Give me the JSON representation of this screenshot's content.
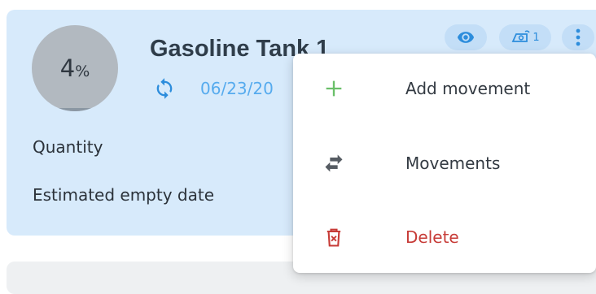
{
  "tank": {
    "percent_value": "4",
    "percent_sign": "%",
    "fill_fraction": 0.04,
    "name": "Gasoline Tank 1",
    "date": "06/23/20",
    "quantity_label": "Quantity",
    "empty_date_label": "Estimated empty date"
  },
  "badges": {
    "sensor_count": "1"
  },
  "menu": {
    "items": [
      {
        "label": "Add movement",
        "icon": "plus-icon"
      },
      {
        "label": "Movements",
        "icon": "swap-arrows-icon"
      },
      {
        "label": "Delete",
        "icon": "trash-icon"
      }
    ]
  },
  "colors": {
    "card_bg": "#d7eafb",
    "accent_blue": "#2d8ddc",
    "add_green": "#6abf69",
    "delete_red": "#c73b37"
  }
}
